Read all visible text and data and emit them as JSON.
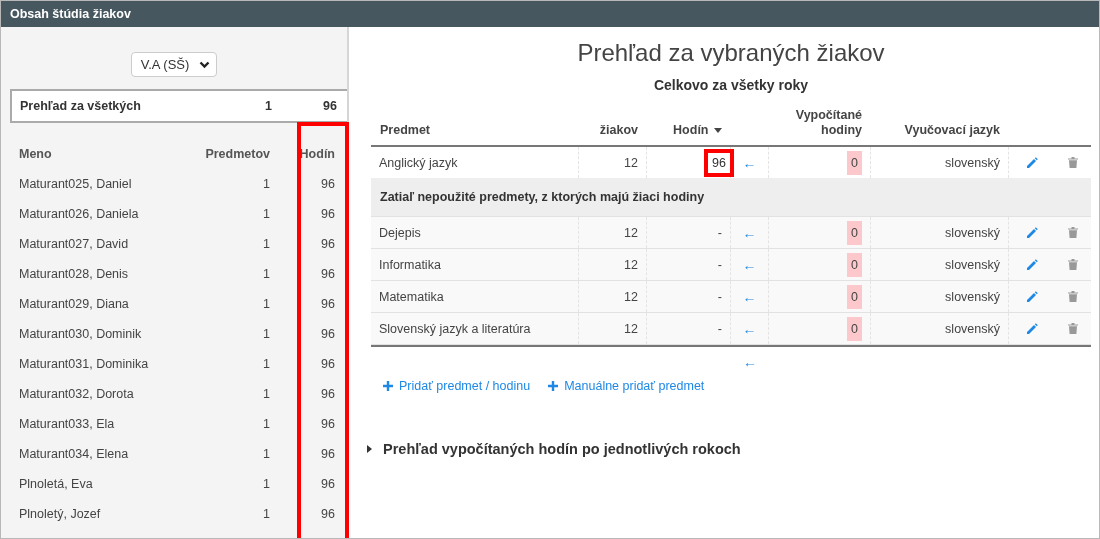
{
  "window": {
    "title": "Obsah štúdia žiakov"
  },
  "sidebar": {
    "class_select": {
      "value": "V.A (SŠ)"
    },
    "summary": {
      "label": "Prehľad za všetkých",
      "subjects": "1",
      "hours": "96"
    },
    "columns": [
      "Meno",
      "Predmetov",
      "Hodín"
    ],
    "hours_column_highlighted": true,
    "students": [
      {
        "name": "Maturant025, Daniel",
        "subjects": "1",
        "hours": "96"
      },
      {
        "name": "Maturant026, Daniela",
        "subjects": "1",
        "hours": "96"
      },
      {
        "name": "Maturant027, David",
        "subjects": "1",
        "hours": "96"
      },
      {
        "name": "Maturant028, Denis",
        "subjects": "1",
        "hours": "96"
      },
      {
        "name": "Maturant029, Diana",
        "subjects": "1",
        "hours": "96"
      },
      {
        "name": "Maturant030, Dominik",
        "subjects": "1",
        "hours": "96"
      },
      {
        "name": "Maturant031, Dominika",
        "subjects": "1",
        "hours": "96"
      },
      {
        "name": "Maturant032, Dorota",
        "subjects": "1",
        "hours": "96"
      },
      {
        "name": "Maturant033, Ela",
        "subjects": "1",
        "hours": "96"
      },
      {
        "name": "Maturant034, Elena",
        "subjects": "1",
        "hours": "96"
      },
      {
        "name": "Plnoletá, Eva",
        "subjects": "1",
        "hours": "96"
      },
      {
        "name": "Plnoletý, Jozef",
        "subjects": "1",
        "hours": "96"
      }
    ]
  },
  "main": {
    "title": "Prehľad za vybraných žiakov",
    "subtitle": "Celkovo za všetky roky",
    "table": {
      "columns": [
        {
          "label": "Predmet",
          "sorted": false
        },
        {
          "label": "žiakov",
          "sorted": false
        },
        {
          "label": "Hodín",
          "sorted": true
        },
        {
          "label": "Vypočítané hodiny",
          "sorted": false
        },
        {
          "label": "Vyučovací jazyk",
          "sorted": false
        }
      ],
      "rows": [
        {
          "kind": "subject",
          "name": "Anglický jazyk",
          "students": "12",
          "hours": "96",
          "highlighted": true,
          "arrow": "←",
          "computed": "0",
          "language": "slovenský"
        },
        {
          "kind": "group",
          "label": "Zatiaľ nepoužité predmety, z ktorých majú žiaci hodiny"
        },
        {
          "kind": "subject",
          "name": "Dejepis",
          "students": "12",
          "hours": "-",
          "highlighted": false,
          "arrow": "←",
          "computed": "0",
          "language": "slovenský"
        },
        {
          "kind": "subject",
          "name": "Informatika",
          "students": "12",
          "hours": "-",
          "highlighted": false,
          "arrow": "←",
          "computed": "0",
          "language": "slovenský"
        },
        {
          "kind": "subject",
          "name": "Matematika",
          "students": "12",
          "hours": "-",
          "highlighted": false,
          "arrow": "←",
          "computed": "0",
          "language": "slovenský"
        },
        {
          "kind": "subject",
          "name": "Slovenský jazyk a literatúra",
          "students": "12",
          "hours": "-",
          "highlighted": false,
          "arrow": "←",
          "computed": "0",
          "language": "slovenský"
        }
      ],
      "footer_arrow": "←"
    },
    "links": [
      {
        "label": "Pridať predmet / hodinu"
      },
      {
        "label": "Manuálne pridať predmet"
      }
    ],
    "section": {
      "label": "Prehľad vypočítaných hodín po jednotlivých rokoch",
      "expanded": false
    }
  }
}
